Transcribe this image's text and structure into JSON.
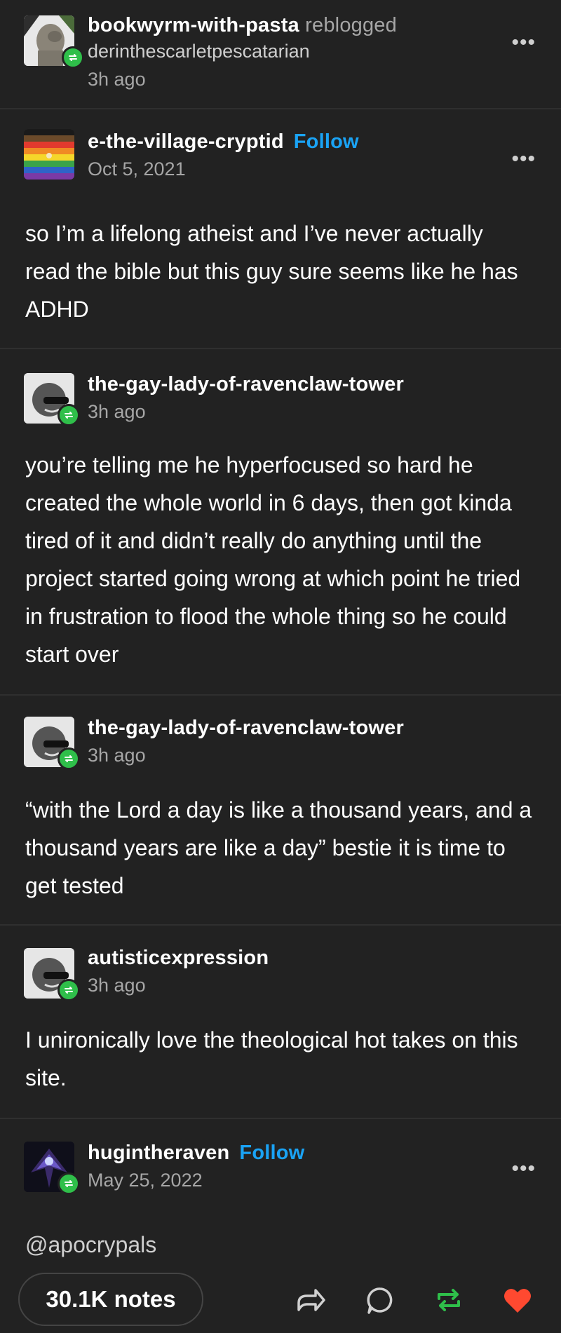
{
  "header": {
    "reblogger": "bookwyrm-with-pasta",
    "action": "reblogged",
    "source": "derinthescarletpescatarian",
    "time": "3h ago"
  },
  "posts": [
    {
      "username": "e-the-village-cryptid",
      "follow_label": "Follow",
      "time": "Oct 5, 2021",
      "text": "so I’m a lifelong atheist and I’ve never actually read the bible but this guy sure seems like he has ADHD"
    },
    {
      "username": "the-gay-lady-of-ravenclaw-tower",
      "time": "3h ago",
      "text": "you’re telling me he hyperfocused so hard he created the whole world in 6 days, then got kinda tired of it and didn’t really do anything until the project started going wrong at which point he tried in frustration to flood the whole thing so he could start over"
    },
    {
      "username": "the-gay-lady-of-ravenclaw-tower",
      "time": "3h ago",
      "text": "“with the Lord a day is like a thousand years, and a thousand years are like a day” bestie it is time to get tested"
    },
    {
      "username": "autisticexpression",
      "time": "3h ago",
      "text": "I unironically love the theological hot takes on this site."
    },
    {
      "username": "hugintheraven",
      "follow_label": "Follow",
      "time": "May 25, 2022",
      "text": "@apocrypals"
    }
  ],
  "more_label": "•••",
  "footer": {
    "notes_label": "30.1K notes",
    "icons": [
      "share-icon",
      "reply-icon",
      "reblog-icon",
      "like-icon"
    ]
  },
  "colors": {
    "background": "#222222",
    "follow": "#1aa3f5",
    "reblog": "#2fbf4a",
    "like": "#ff4930",
    "meta": "#a6a6a6"
  }
}
